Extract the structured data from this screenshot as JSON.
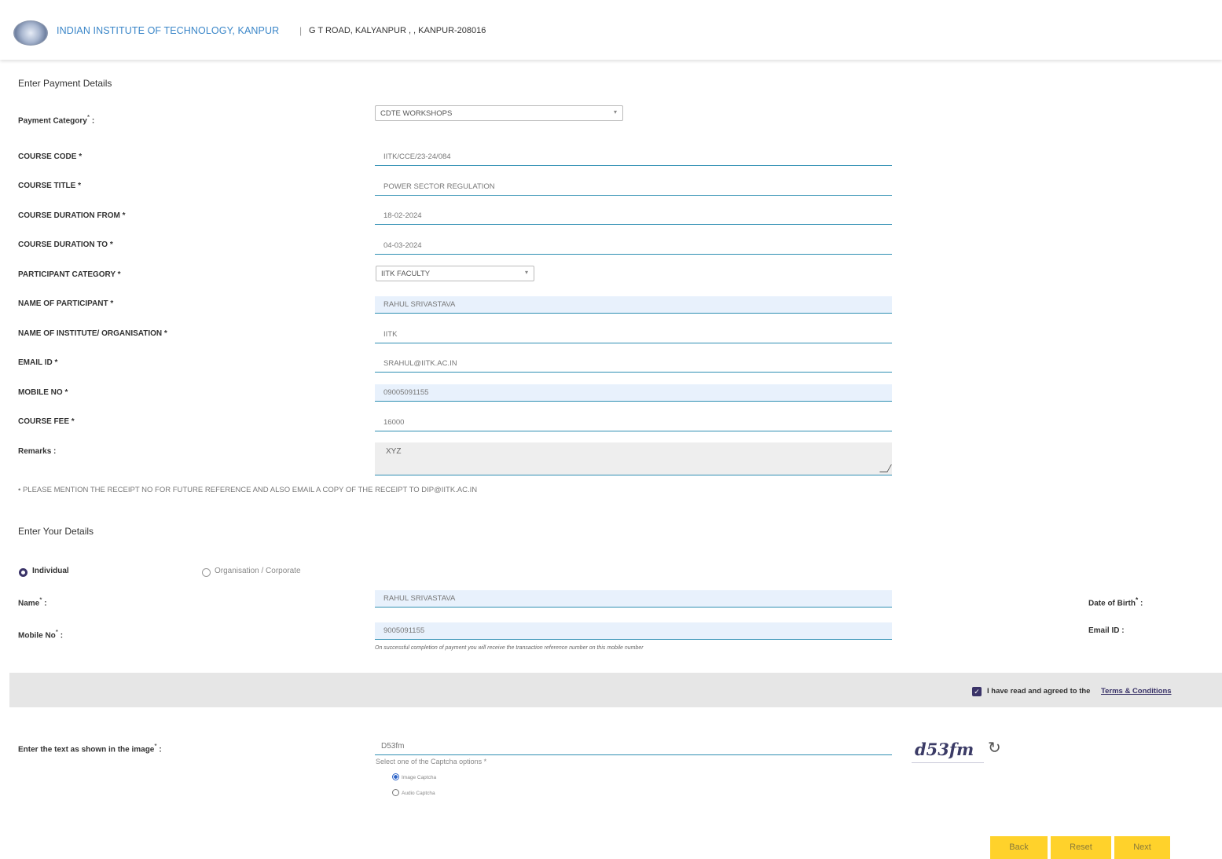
{
  "header": {
    "institute": "INDIAN INSTITUTE OF TECHNOLOGY, KANPUR",
    "separator": "|",
    "address": "G T ROAD, KALYANPUR , , KANPUR-208016"
  },
  "payment": {
    "section_title": "Enter Payment Details",
    "category_label": "Payment Category",
    "category_value": "CDTE WORKSHOPS",
    "fields": {
      "course_code": {
        "label": "COURSE CODE *",
        "value": "IITK/CCE/23-24/084"
      },
      "course_title": {
        "label": "COURSE TITLE *",
        "value": "POWER SECTOR REGULATION"
      },
      "duration_from": {
        "label": "COURSE DURATION FROM *",
        "value": "18-02-2024"
      },
      "duration_to": {
        "label": "COURSE DURATION TO *",
        "value": "04-03-2024"
      },
      "participant_category": {
        "label": "PARTICIPANT CATEGORY *",
        "value": "IITK FACULTY"
      },
      "participant_name": {
        "label": "NAME OF PARTICIPANT *",
        "value": "RAHUL SRIVASTAVA"
      },
      "institute": {
        "label": "NAME OF INSTITUTE/ ORGANISATION *",
        "value": "IITK"
      },
      "email": {
        "label": "EMAIL ID *",
        "value": "SRAHUL@IITK.AC.IN"
      },
      "mobile": {
        "label": "MOBILE NO *",
        "value": "09005091155"
      },
      "fee": {
        "label": "COURSE FEE *",
        "value": "16000"
      }
    },
    "remarks_label": "Remarks :",
    "remarks_value": "XYZ",
    "note": "•   PLEASE MENTION THE RECEIPT NO FOR FUTURE REFERENCE AND ALSO EMAIL A COPY OF THE RECEIPT TO DIP@IITK.AC.IN"
  },
  "details": {
    "section_title": "Enter Your Details",
    "type_individual": "Individual",
    "type_org": "Organisation / Corporate",
    "name_label": "Name",
    "name_value": "RAHUL SRIVASTAVA",
    "dob_label": "Date of Birth",
    "mobile_label": "Mobile No",
    "mobile_value": "9005091155",
    "email_label": "Email ID :",
    "mobile_hint": "On successful completion of payment you will receive the transaction reference number on this mobile number"
  },
  "terms": {
    "text": "I have read and agreed to the",
    "link": "Terms & Conditions"
  },
  "captcha": {
    "label": "Enter the text as shown in the image",
    "value": "D53fm",
    "options_title": "Select one of the Captcha options *",
    "option_image": "Image Captcha",
    "option_audio": "Audio Captcha",
    "image_text": "d53fm",
    "refresh_glyph": "↻"
  },
  "buttons": {
    "back": "Back",
    "reset": "Reset",
    "next": "Next"
  },
  "colors": {
    "accent": "#3a3368",
    "field_line": "#2f8fb3",
    "button": "#ffd22b",
    "header_text": "#3a86c8"
  }
}
